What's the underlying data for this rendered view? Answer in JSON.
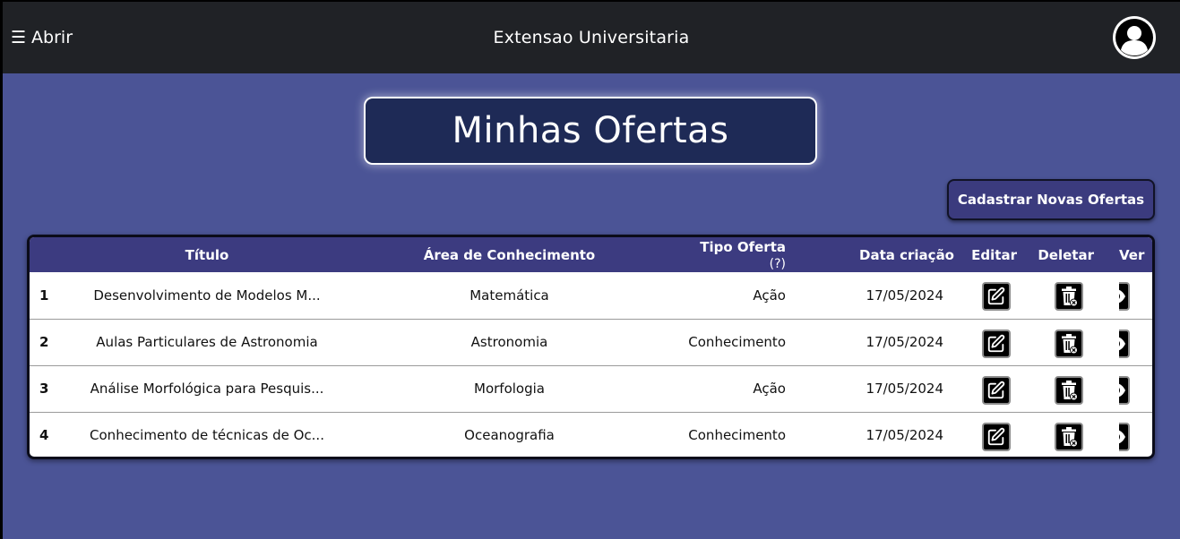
{
  "navbar": {
    "menu_icon": "hamburger-icon",
    "menu_label": "Abrir",
    "app_title": "Extensao Universitaria",
    "avatar_icon": "user-avatar-icon"
  },
  "page": {
    "title": "Minhas Ofertas",
    "new_offer_label": "Cadastrar Novas Ofertas"
  },
  "table": {
    "headers": {
      "title": "Título",
      "area": "Área de Conhecimento",
      "type": "Tipo Oferta",
      "type_hint": "(?)",
      "date": "Data criação",
      "edit": "Editar",
      "delete": "Deletar",
      "view": "Ver"
    },
    "rows": [
      {
        "num": "1",
        "title": "Desenvolvimento de Modelos M...",
        "area": "Matemática",
        "type": "Ação",
        "date": "17/05/2024"
      },
      {
        "num": "2",
        "title": "Aulas Particulares de Astronomia",
        "area": "Astronomia",
        "type": "Conhecimento",
        "date": "17/05/2024"
      },
      {
        "num": "3",
        "title": "Análise Morfológica para Pesquis...",
        "area": "Morfologia",
        "type": "Ação",
        "date": "17/05/2024"
      },
      {
        "num": "4",
        "title": "Conhecimento de técnicas de Oc...",
        "area": "Oceanografia",
        "type": "Conhecimento",
        "date": "17/05/2024"
      }
    ],
    "icons": {
      "edit": "edit-icon",
      "delete": "trash-icon",
      "view": "eye-icon"
    }
  },
  "colors": {
    "page_background": "#4b5496",
    "navbar": "#202226",
    "title_box": "#1e2a56",
    "table_header": "#3c3b80",
    "button": "#3b3b7e"
  }
}
